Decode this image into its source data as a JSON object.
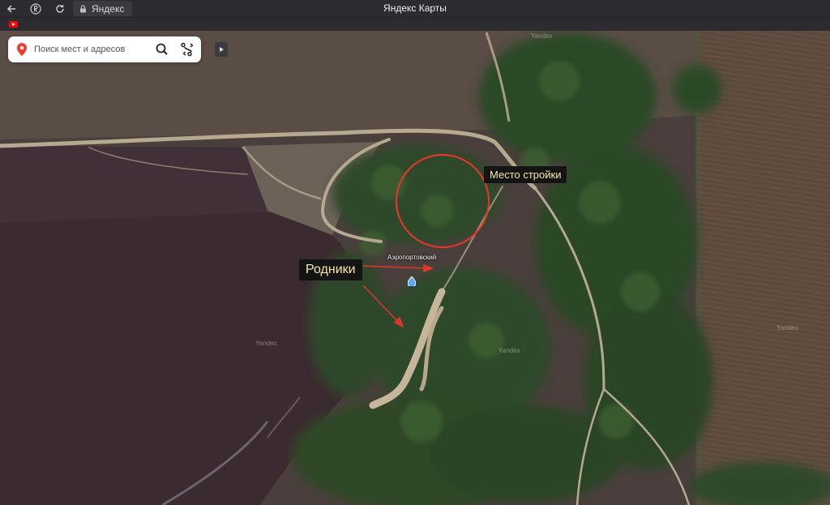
{
  "browser": {
    "back_icon": "arrow-left-icon",
    "yandex_icon": "yandex-y-icon",
    "reload_icon": "reload-icon",
    "lock_icon": "lock-icon",
    "url_text": "Яндекс",
    "page_title": "Яндекс Карты"
  },
  "bookmarks": {
    "youtube_icon": "youtube-icon"
  },
  "search": {
    "placeholder": "Поиск мест и адресов",
    "value": "",
    "search_icon": "search-icon",
    "routes_icon": "route-icon"
  },
  "map": {
    "annotations": {
      "construction_site": "Место стройки",
      "springs": "Родники"
    },
    "poi": {
      "name": "Аэропортовский",
      "icon": "water-drop-icon"
    },
    "watermark": "Yandex",
    "colors": {
      "annotation_circle": "#e0362c",
      "annotation_arrow": "#e0362c",
      "label_bg": "#141414",
      "label_text": "#f5e9a8",
      "pin": "#f33a2c"
    }
  }
}
